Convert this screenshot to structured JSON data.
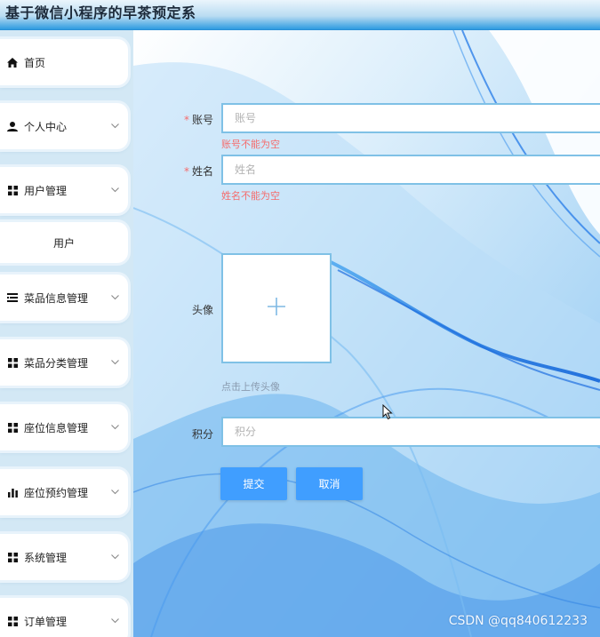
{
  "app": {
    "title": "基于微信小程序的早茶预定系"
  },
  "sidebar": {
    "items": [
      {
        "label": "首页",
        "icon": "home-icon",
        "has_submenu": false
      },
      {
        "label": "个人中心",
        "icon": "user-icon",
        "has_submenu": true
      },
      {
        "label": "用户管理",
        "icon": "grid-icon",
        "has_submenu": true,
        "expanded": true,
        "children": [
          "用户"
        ]
      },
      {
        "label": "菜品信息管理",
        "icon": "list-icon",
        "has_submenu": true
      },
      {
        "label": "菜品分类管理",
        "icon": "grid-icon",
        "has_submenu": true
      },
      {
        "label": "座位信息管理",
        "icon": "grid-icon",
        "has_submenu": true
      },
      {
        "label": "座位预约管理",
        "icon": "bar-chart-icon",
        "has_submenu": true
      },
      {
        "label": "系统管理",
        "icon": "grid-icon",
        "has_submenu": true
      },
      {
        "label": "订单管理",
        "icon": "grid-icon",
        "has_submenu": true
      }
    ]
  },
  "form": {
    "account": {
      "label": "账号",
      "required": true,
      "placeholder": "账号",
      "value": "",
      "error": "账号不能为空"
    },
    "name": {
      "label": "姓名",
      "required": true,
      "placeholder": "姓名",
      "value": "",
      "error": "姓名不能为空"
    },
    "avatar": {
      "label": "头像",
      "hint": "点击上传头像"
    },
    "points": {
      "label": "积分",
      "placeholder": "积分",
      "value": ""
    },
    "submit_label": "提交",
    "cancel_label": "取消"
  },
  "colors": {
    "accent": "#409eff",
    "error": "#f56c6c",
    "input_border": "#7fc1e6",
    "header_blue": "#2e9be0"
  },
  "watermark": "CSDN @qq840612233"
}
